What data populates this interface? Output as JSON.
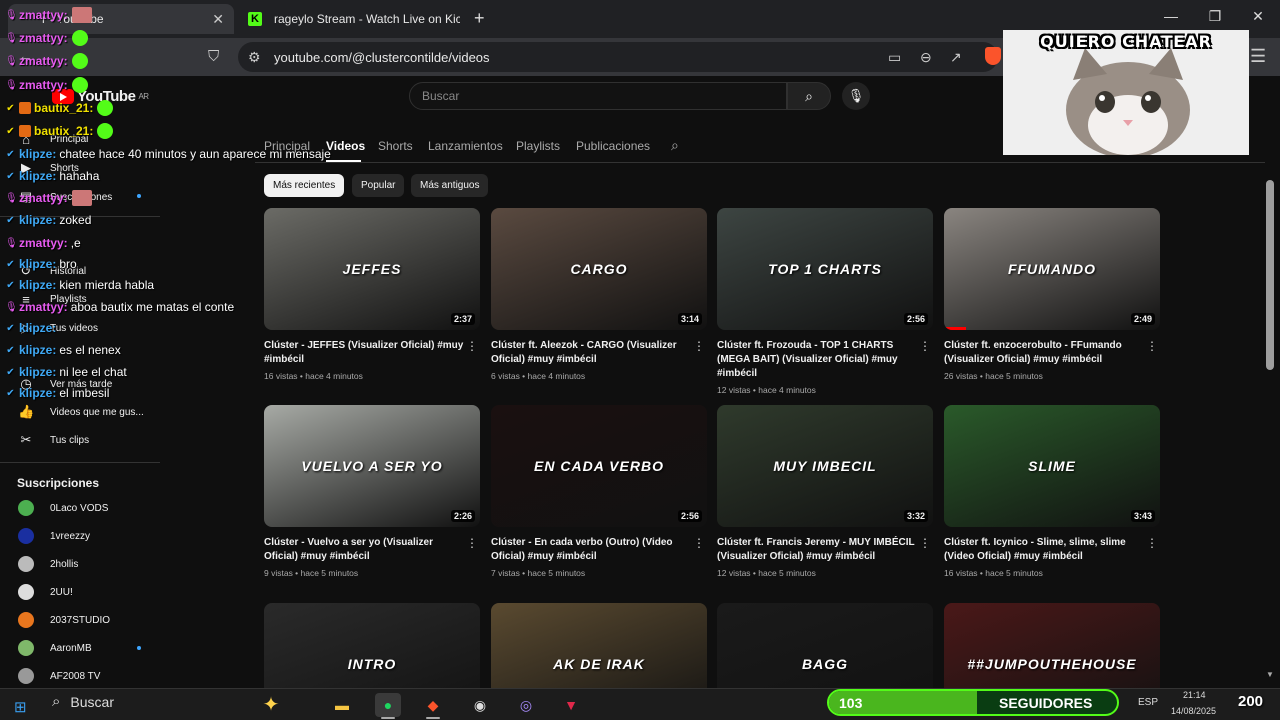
{
  "browser": {
    "tabs": [
      {
        "title": "(60) Clúster - YouTube",
        "visible_title": "r - YouTube",
        "active": true
      },
      {
        "title": "rageylo Stream - Watch Live on Kick",
        "active": false
      }
    ],
    "url": "youtube.com/@clustercontilde/videos"
  },
  "youtube": {
    "logo_text": "YouTube",
    "logo_region": "AR",
    "search_placeholder": "Buscar",
    "sidebar": {
      "items": [
        {
          "label": "Principal",
          "icon": "home-icon"
        },
        {
          "label": "Shorts",
          "icon": "shorts-icon"
        },
        {
          "label": "Suscripciones",
          "icon": "subscriptions-icon"
        },
        {
          "label": "Tú",
          "icon": "you-icon"
        },
        {
          "label": "Historial",
          "icon": "history-icon"
        },
        {
          "label": "Playlists",
          "icon": "playlist-icon"
        },
        {
          "label": "Tus videos",
          "icon": "video-icon"
        },
        {
          "label": "Ver más tarde",
          "icon": "clock-icon"
        },
        {
          "label": "Videos que me gus...",
          "icon": "thumb-up-icon"
        },
        {
          "label": "Tus clips",
          "icon": "scissors-icon"
        }
      ],
      "subs_header": "Suscripciones",
      "subscriptions": [
        {
          "name": "0Laco VODS",
          "color": "#4caf50",
          "dot": false
        },
        {
          "name": "1vreezzy",
          "color": "#1a2fa0",
          "dot": false
        },
        {
          "name": "2hollis",
          "color": "#bbbbbb",
          "dot": false
        },
        {
          "name": "2UU!",
          "color": "#dddddd",
          "dot": false
        },
        {
          "name": "2037STUDIO",
          "color": "#e8761e",
          "dot": false
        },
        {
          "name": "AaronMB",
          "color": "#7fb86a",
          "dot": true
        },
        {
          "name": "AF2008 TV",
          "color": "#999999",
          "dot": false
        }
      ]
    },
    "channel_tabs": [
      "Principal",
      "Videos",
      "Shorts",
      "Lanzamientos",
      "Playlists",
      "Publicaciones"
    ],
    "active_tab": "Videos",
    "chips": [
      "Más recientes",
      "Popular",
      "Más antiguos"
    ],
    "videos": [
      {
        "title": "Clúster - JEFFES (Visualizer Oficial) #muy #imbécil",
        "meta": "16 vistas • hace 4 minutos",
        "duration": "2:37",
        "overlay": "JEFFES",
        "bg": "#6b6b66"
      },
      {
        "title": "Clúster ft. Aleezok - CARGO (Visualizer Oficial) #muy #imbécil",
        "meta": "6 vistas • hace 4 minutos",
        "duration": "3:14",
        "overlay": "CARGO",
        "bg": "#5a4a40"
      },
      {
        "title": "Clúster ft. Frozouda - TOP 1 CHARTS (MEGA BAIT) (Visualizer Oficial) #muy #imbécil",
        "meta": "12 vistas • hace 4 minutos",
        "duration": "2:56",
        "overlay": "TOP 1 CHARTS",
        "bg": "#3d4542"
      },
      {
        "title": "Clúster ft. enzocerobulto - FFumando (Visualizer Oficial) #muy #imbécil",
        "meta": "26 vistas • hace 5 minutos",
        "duration": "2:49",
        "overlay": "FFUMANDO",
        "bg": "#8a8580",
        "progress": 0.1
      },
      {
        "title": "Clúster - Vuelvo a ser yo (Visualizer Oficial) #muy #imbécil",
        "meta": "9 vistas • hace 5 minutos",
        "duration": "2:26",
        "overlay": "VUELVO A SER YO",
        "bg": "#a7aaa5"
      },
      {
        "title": "Clúster - En cada verbo (Outro) (Video Oficial) #muy #imbécil",
        "meta": "7 vistas • hace 5 minutos",
        "duration": "2:56",
        "overlay": "EN CADA VERBO",
        "bg": "#1a1010"
      },
      {
        "title": "Clúster ft. Francis Jeremy - MUY IMBÉCIL (Visualizer Oficial) #muy #imbécil",
        "meta": "12 vistas • hace 5 minutos",
        "duration": "3:32",
        "overlay": "MUY IMBECIL",
        "bg": "#2f3a2c"
      },
      {
        "title": "Clúster ft. Icynico - Slime, slime, slime (Video Oficial) #muy #imbécil",
        "meta": "16 vistas • hace 5 minutos",
        "duration": "3:43",
        "overlay": "SLIME",
        "bg": "#2a5a2a"
      },
      {
        "title": "",
        "meta": "",
        "duration": "",
        "overlay": "INTRO",
        "bg": "#2a2a2a"
      },
      {
        "title": "",
        "meta": "",
        "duration": "",
        "overlay": "AK DE IRAK",
        "bg": "#5a4a30"
      },
      {
        "title": "",
        "meta": "",
        "duration": "",
        "overlay": "BAGG",
        "bg": "#1a1a1a"
      },
      {
        "title": "",
        "meta": "",
        "duration": "",
        "overlay": "##JUMPOUTHEHOUSE",
        "bg": "#4a1818"
      }
    ]
  },
  "cat_overlay": {
    "caption": "QUIERO CHATEAR"
  },
  "chat": [
    {
      "user": "zmattyy:",
      "color": "#e75bf0",
      "msg": "",
      "emote": "sq"
    },
    {
      "user": "zmattyy:",
      "color": "#e75bf0",
      "msg": "",
      "emote": "green"
    },
    {
      "user": "zmattyy:",
      "color": "#e75bf0",
      "msg": "",
      "emote": "green"
    },
    {
      "user": "zmattyy:",
      "color": "#e75bf0",
      "msg": "",
      "emote": "green"
    },
    {
      "user": "bautix_21:",
      "color": "#f0e000",
      "msg": "",
      "emote": "green",
      "badge": "sq"
    },
    {
      "user": "bautix_21:",
      "color": "#f0e000",
      "msg": "",
      "emote": "green",
      "badge": "sq"
    },
    {
      "user": "klipze:",
      "color": "#3fa9f5",
      "msg": "chatee hace 40 minutos y aun aparece mi mensaje"
    },
    {
      "user": "klipze:",
      "color": "#3fa9f5",
      "msg": "hahaha"
    },
    {
      "user": "zmattyy:",
      "color": "#e75bf0",
      "msg": "",
      "emote": "sq"
    },
    {
      "user": "klipze:",
      "color": "#3fa9f5",
      "msg": "zoked"
    },
    {
      "user": "zmattyy:",
      "color": "#e75bf0",
      "msg": ",e"
    },
    {
      "user": "klipze:",
      "color": "#3fa9f5",
      "msg": "bro"
    },
    {
      "user": "klipze:",
      "color": "#3fa9f5",
      "msg": "kien mierda habla"
    },
    {
      "user": "zmattyy:",
      "color": "#e75bf0",
      "msg": "aboa bautix me matas el conte"
    },
    {
      "user": "klipze:",
      "color": "#3fa9f5",
      "msg": ""
    },
    {
      "user": "klipze:",
      "color": "#3fa9f5",
      "msg": "es el nenex"
    },
    {
      "user": "klipze:",
      "color": "#3fa9f5",
      "msg": "ni lee el chat"
    },
    {
      "user": "klipze:",
      "color": "#3fa9f5",
      "msg": "el imbesil"
    }
  ],
  "taskbar": {
    "search_label": "Buscar",
    "followers": "103",
    "followers_label": "SEGUIDORES",
    "followers_goal": "200",
    "followers_progress": 0.515,
    "lang": "ESP",
    "time": "21:14",
    "date": "14/08/2025"
  }
}
